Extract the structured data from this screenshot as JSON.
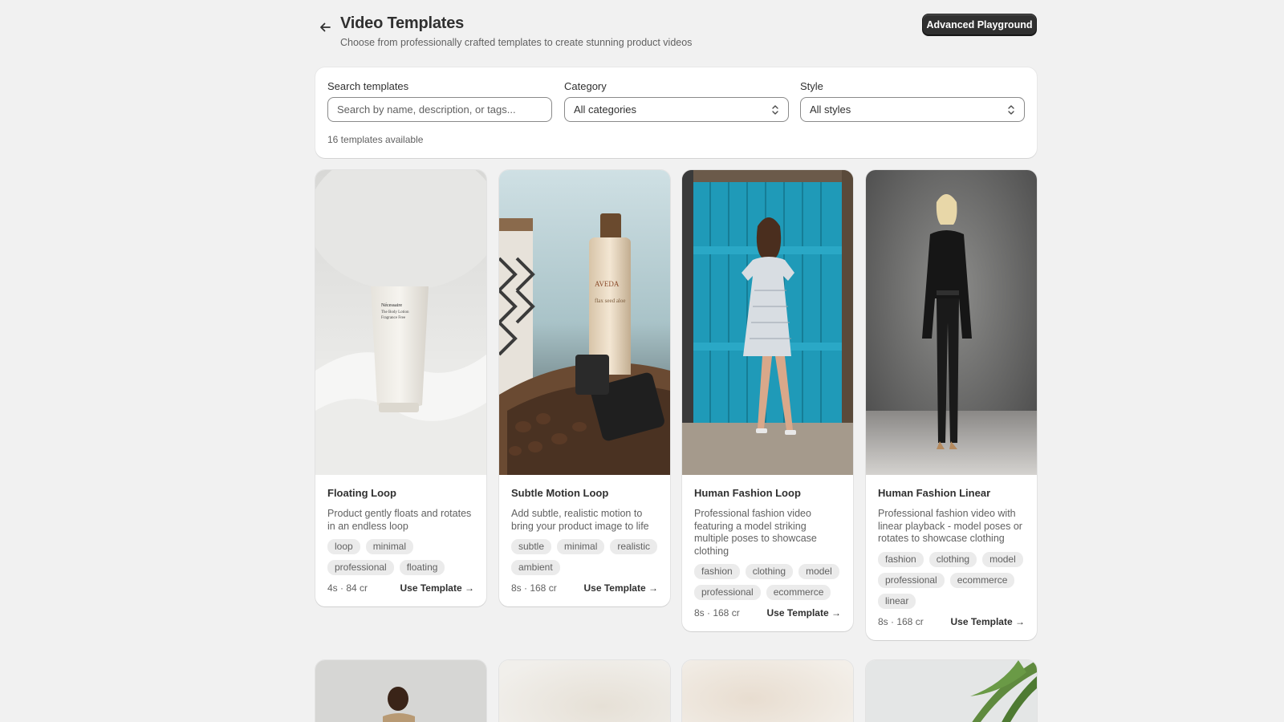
{
  "header": {
    "title": "Video Templates",
    "subtitle": "Choose from professionally crafted templates to create stunning product videos",
    "primary_action": "Advanced Playground"
  },
  "filters": {
    "search_label": "Search templates",
    "search_placeholder": "Search by name, description, or tags...",
    "search_value": "",
    "category_label": "Category",
    "category_value": "All categories",
    "style_label": "Style",
    "style_value": "All styles",
    "count_text": "16 templates available"
  },
  "cta_label": "Use Template →",
  "templates": [
    {
      "title": "Floating Loop",
      "description": "Product gently floats and rotates in an endless loop",
      "tags": [
        "loop",
        "minimal",
        "professional",
        "floating"
      ],
      "meta": "4s · 84 cr",
      "image": "white cream tube on white linen"
    },
    {
      "title": "Subtle Motion Loop",
      "description": "Add subtle, realistic motion to bring your product image to life",
      "tags": [
        "subtle",
        "minimal",
        "realistic",
        "ambient"
      ],
      "meta": "8s · 168 cr",
      "image": "bottle on wooden bowl with stones"
    },
    {
      "title": "Human Fashion Loop",
      "description": "Professional fashion video featuring a model striking multiple poses to showcase clothing",
      "tags": [
        "fashion",
        "clothing",
        "model",
        "professional",
        "ecommerce"
      ],
      "meta": "8s · 168 cr",
      "image": "model in striped dress before blue door"
    },
    {
      "title": "Human Fashion Linear",
      "description": "Professional fashion video with linear playback - model poses or rotates to showcase clothing",
      "tags": [
        "fashion",
        "clothing",
        "model",
        "professional",
        "ecommerce",
        "linear"
      ],
      "meta": "8s · 168 cr",
      "image": "model in black suit on grey backdrop"
    }
  ],
  "colors": {
    "background": "#f1f1f1",
    "card": "#ffffff",
    "primary_button": "#303030",
    "tag_bg": "#ebebeb"
  }
}
